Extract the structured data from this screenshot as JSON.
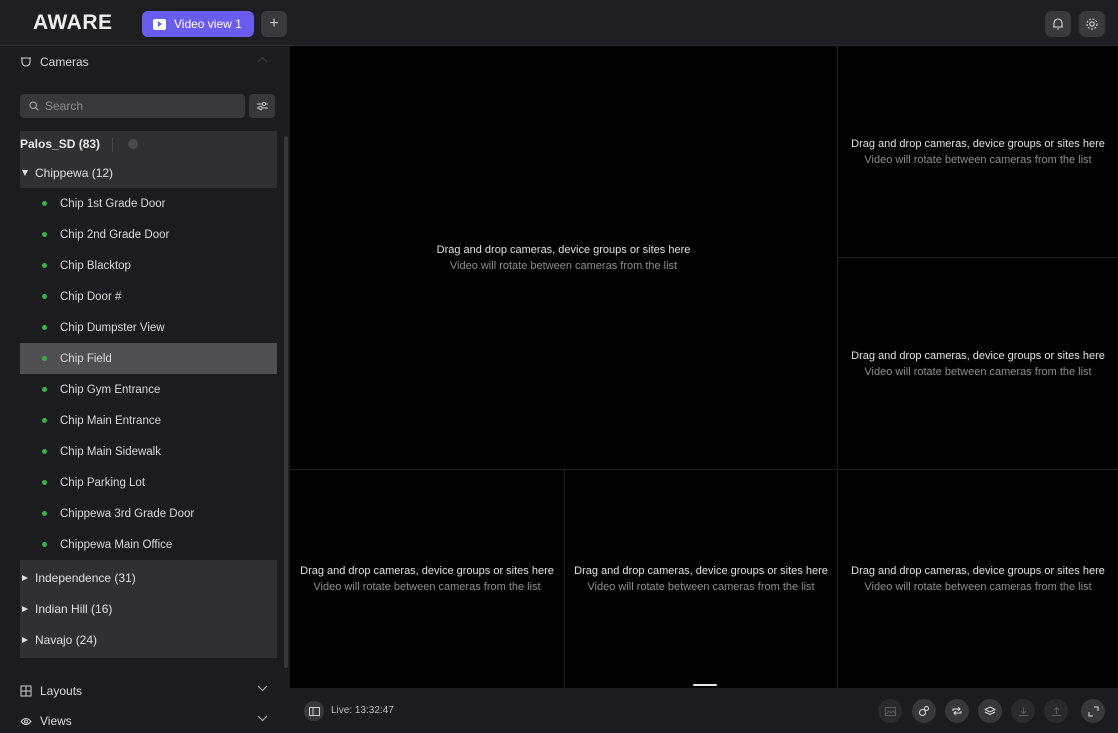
{
  "app": {
    "logo": "AWARE"
  },
  "tabs": [
    {
      "label": "Video view 1",
      "active": true
    }
  ],
  "add_tab_label": "+",
  "header_icons": [
    "bell-icon",
    "settings-icon"
  ],
  "sidebar": {
    "cameras_section": "Cameras",
    "search_placeholder": "Search",
    "site": {
      "label": "Palos_SD (83)"
    },
    "expanded_group": {
      "label": "Chippewa (12)"
    },
    "cameras": [
      {
        "label": "Chip 1st Grade Door",
        "status": "online"
      },
      {
        "label": "Chip 2nd Grade Door",
        "status": "online"
      },
      {
        "label": "Chip Blacktop",
        "status": "online"
      },
      {
        "label": "Chip Door #",
        "status": "online"
      },
      {
        "label": "Chip Dumpster View",
        "status": "online"
      },
      {
        "label": "Chip Field",
        "status": "online",
        "selected": true
      },
      {
        "label": "Chip Gym Entrance",
        "status": "online"
      },
      {
        "label": "Chip Main Entrance",
        "status": "online"
      },
      {
        "label": "Chip Main Sidewalk",
        "status": "online"
      },
      {
        "label": "Chip Parking Lot",
        "status": "online"
      },
      {
        "label": "Chippewa 3rd Grade Door",
        "status": "online"
      },
      {
        "label": "Chippewa Main Office",
        "status": "online"
      }
    ],
    "collapsed_groups": [
      {
        "label": "Independence (31)"
      },
      {
        "label": "Indian Hill (16)"
      },
      {
        "label": "Navajo (24)"
      }
    ],
    "layouts_section": "Layouts",
    "views_section": "Views"
  },
  "grid": {
    "drop_title": "Drag and drop cameras, device groups or sites here",
    "drop_subtitle": "Video will rotate between cameras from the list"
  },
  "bottombar": {
    "live_label": "Live: 13:32:47",
    "tool_icons": [
      "image-icon",
      "people-icon",
      "rotate-icon",
      "layers-icon",
      "download-icon",
      "upload-icon",
      "fullscreen-icon"
    ]
  },
  "colors": {
    "accent": "#6b5cf0",
    "online": "#36b34a",
    "background": "#000000"
  }
}
